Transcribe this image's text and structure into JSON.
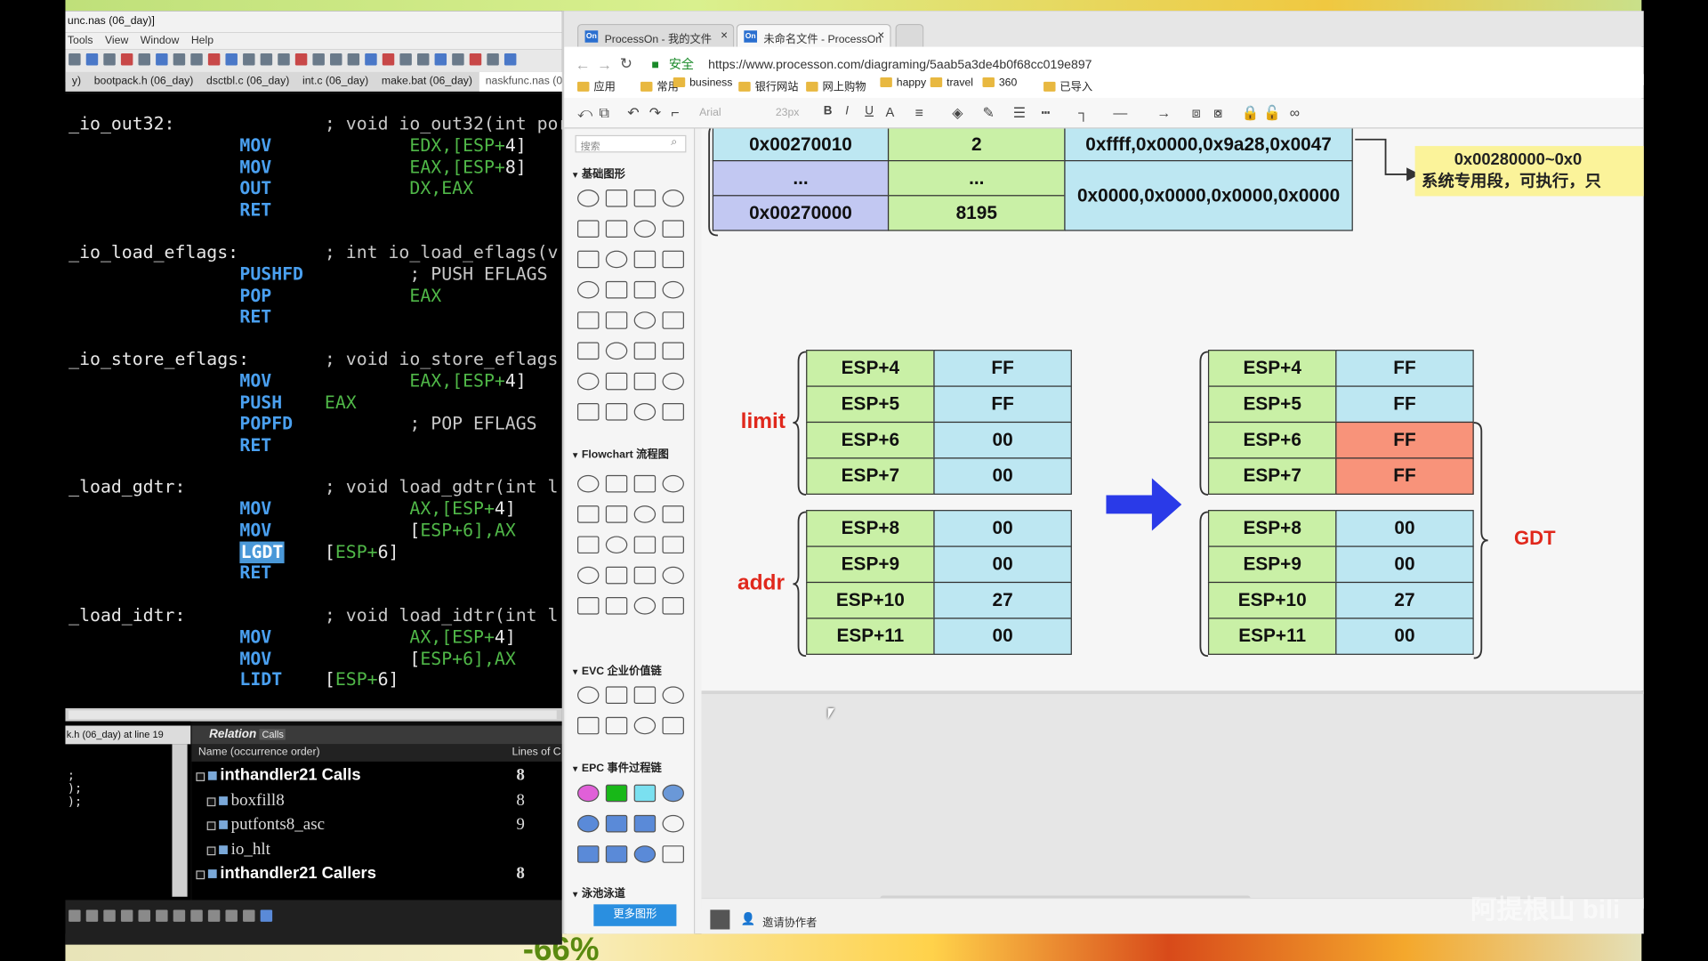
{
  "editor": {
    "title": "unc.nas (06_day)]",
    "menu": [
      "Tools",
      "View",
      "Window",
      "Help"
    ],
    "tabs": [
      {
        "label": "y)"
      },
      {
        "label": "bootpack.h (06_day)"
      },
      {
        "label": "dsctbl.c (06_day)"
      },
      {
        "label": "int.c (06_day)"
      },
      {
        "label": "make.bat (06_day)"
      },
      {
        "label": "naskfunc.nas (06"
      }
    ],
    "code": [
      {
        "label": "_io_out32:",
        "comment": "; void io_out32(int port, int"
      },
      {
        "kw": "MOV",
        "ops": [
          "EDX,[",
          "ESP+",
          "4]"
        ]
      },
      {
        "kw": "MOV",
        "ops": [
          "EAX,[",
          "ESP+",
          "8]"
        ]
      },
      {
        "kw": "OUT",
        "ops": [
          "DX,",
          "EAX"
        ]
      },
      {
        "kw": "RET"
      },
      {
        "label": "_io_load_eflags:",
        "comment": "; int io_load_eflags(v"
      },
      {
        "kw": "PUSHFD",
        "comment": "; PUSH EFLAGS"
      },
      {
        "kw": "POP",
        "ops": [
          "EAX"
        ]
      },
      {
        "kw": "RET"
      },
      {
        "label": "_io_store_eflags:",
        "comment": "; void io_store_eflags"
      },
      {
        "kw": "MOV",
        "ops": [
          "EAX,[",
          "ESP+",
          "4]"
        ]
      },
      {
        "kw": "PUSH",
        "ops": [
          "EAX"
        ]
      },
      {
        "kw": "POPFD",
        "comment": "; POP EFLAGS"
      },
      {
        "kw": "RET"
      },
      {
        "label": "_load_gdtr:",
        "comment": "; void load_gdtr(int l"
      },
      {
        "kw": "MOV",
        "ops": [
          "AX,[",
          "ESP+",
          "4]"
        ]
      },
      {
        "kw": "MOV",
        "ops": [
          "[",
          "ESP+",
          "6],AX"
        ]
      },
      {
        "kw": "LGDT",
        "ops": [
          "[",
          "ESP+",
          "6]"
        ]
      },
      {
        "kw": "RET"
      },
      {
        "label": "_load_idtr:",
        "comment": "; void load_idtr(int l"
      },
      {
        "kw": "MOV",
        "ops": [
          "AX,[",
          "ESP+",
          "4]"
        ]
      },
      {
        "kw": "MOV",
        "ops": [
          "[",
          "ESP+",
          "6],AX"
        ]
      },
      {
        "kw": "LIDT",
        "ops": [
          "[",
          "ESP+",
          "6]"
        ]
      }
    ],
    "left_panel_header": "k.h (06_day) at line 19",
    "left_panel_lines": [
      ";",
      ");",
      ");"
    ],
    "relation": {
      "title": "Relation",
      "subtitle": "Calls",
      "col_name": "Name (occurrence order)",
      "col_lines": "Lines of C",
      "rows": [
        {
          "name": "inthandler21 Calls",
          "count": "8",
          "bold": true
        },
        {
          "name": "boxfill8",
          "count": "8"
        },
        {
          "name": "putfonts8_asc",
          "count": "9"
        },
        {
          "name": "io_hlt",
          "count": ""
        },
        {
          "name": "inthandler21 Callers",
          "count": "8",
          "bold": true
        }
      ]
    }
  },
  "browser": {
    "tabs": [
      {
        "label": "ProcessOn - 我的文件",
        "icon": "On"
      },
      {
        "label": "未命名文件 - ProcessOn",
        "icon": "On"
      }
    ],
    "security": "安全",
    "url": "https://www.processon.com/diagraming/5aab5a3de4b0f68cc019e897",
    "bookmarks": [
      "应用",
      "常用",
      "business",
      "银行网站",
      "网上购物",
      "happy",
      "travel",
      "360",
      "已导入"
    ],
    "toolbar": {
      "font": "Arial",
      "size": "23px"
    },
    "shapes_panel": {
      "search_placeholder": "搜索",
      "sections": [
        "基础图形",
        "Flowchart 流程图",
        "EVC 企业价值链",
        "EPC 事件过程链",
        "泳池泳道"
      ],
      "more_button": "更多图形"
    },
    "footer": {
      "invite": "邀请协作者"
    }
  },
  "diagram": {
    "top_table": [
      [
        "0x00270010",
        "2",
        "0xffff,0x0000,0x9a28,0x0047"
      ],
      [
        "...",
        "..."
      ],
      [
        "0x00270000",
        "8195",
        "0x0000,0x0000,0x0000,0x0000"
      ]
    ],
    "note": [
      "0x00280000~0x0",
      "系统专用段，可执行，只"
    ],
    "labels": {
      "limit": "limit",
      "addr": "addr",
      "gdt": "GDT"
    },
    "left_stack": [
      [
        "ESP+4",
        "FF"
      ],
      [
        "ESP+5",
        "FF"
      ],
      [
        "ESP+6",
        "00"
      ],
      [
        "ESP+7",
        "00"
      ],
      [
        "ESP+8",
        "00"
      ],
      [
        "ESP+9",
        "00"
      ],
      [
        "ESP+10",
        "27"
      ],
      [
        "ESP+11",
        "00"
      ]
    ],
    "right_stack": [
      [
        "ESP+4",
        "FF"
      ],
      [
        "ESP+5",
        "FF"
      ],
      [
        "ESP+6",
        "FF"
      ],
      [
        "ESP+7",
        "FF"
      ],
      [
        "ESP+8",
        "00"
      ],
      [
        "ESP+9",
        "00"
      ],
      [
        "ESP+10",
        "27"
      ],
      [
        "ESP+11",
        "00"
      ]
    ],
    "right_stack_highlight": [
      "ESP+6",
      "ESP+7"
    ],
    "colors": {
      "green": "#c9f0a6",
      "blue": "#bde7f2",
      "purple": "#c2c8f2",
      "red": "#f8937a",
      "label_red": "#e0281c",
      "arrow": "#2a3ae8"
    }
  },
  "overlay": {
    "percent": "-66%",
    "watermark": "阿提根山 bili"
  }
}
